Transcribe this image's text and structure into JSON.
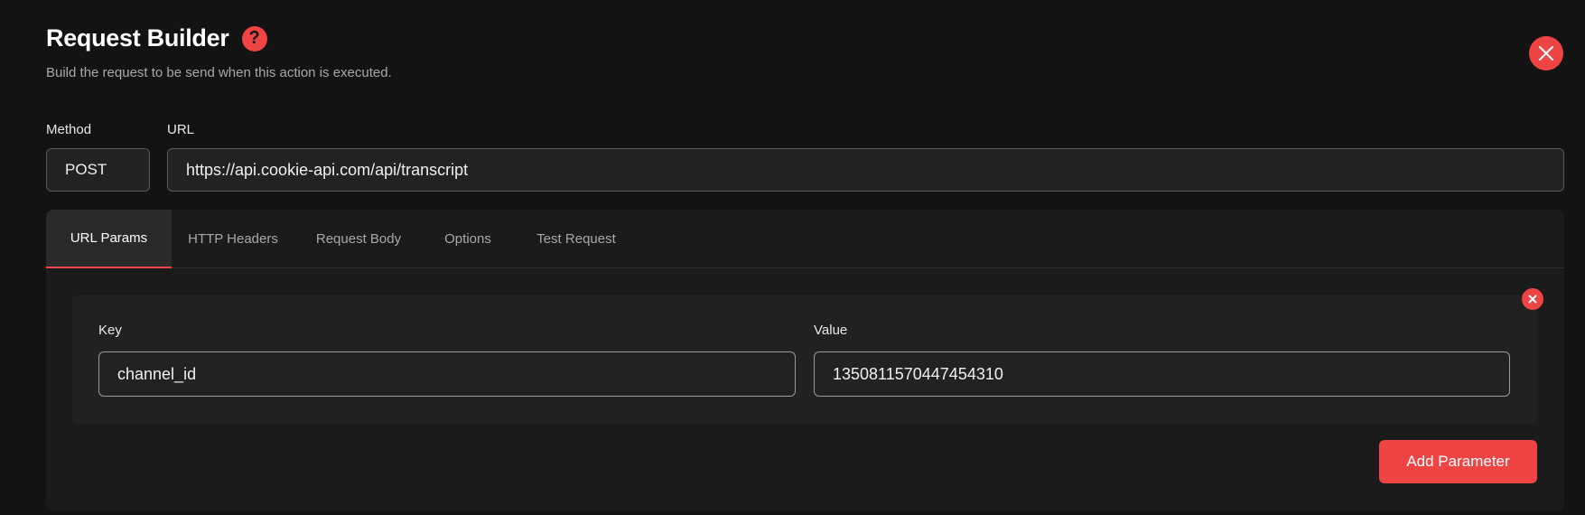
{
  "header": {
    "title": "Request Builder",
    "subtitle": "Build the request to be send when this action is executed.",
    "help_icon": "question-circle-icon",
    "close_icon": "close-icon"
  },
  "method": {
    "label": "Method",
    "value": "POST"
  },
  "url": {
    "label": "URL",
    "value": "https://api.cookie-api.com/api/transcript"
  },
  "tabs": [
    {
      "label": "URL Params",
      "active": true
    },
    {
      "label": "HTTP Headers",
      "active": false
    },
    {
      "label": "Request Body",
      "active": false
    },
    {
      "label": "Options",
      "active": false
    },
    {
      "label": "Test Request",
      "active": false
    }
  ],
  "params": [
    {
      "key_label": "Key",
      "key_value": "channel_id",
      "value_label": "Value",
      "value_value": "1350811570447454310"
    }
  ],
  "add_parameter_label": "Add Parameter",
  "colors": {
    "accent": "#ef4444",
    "background": "#131313",
    "card": "#1b1b1b"
  }
}
